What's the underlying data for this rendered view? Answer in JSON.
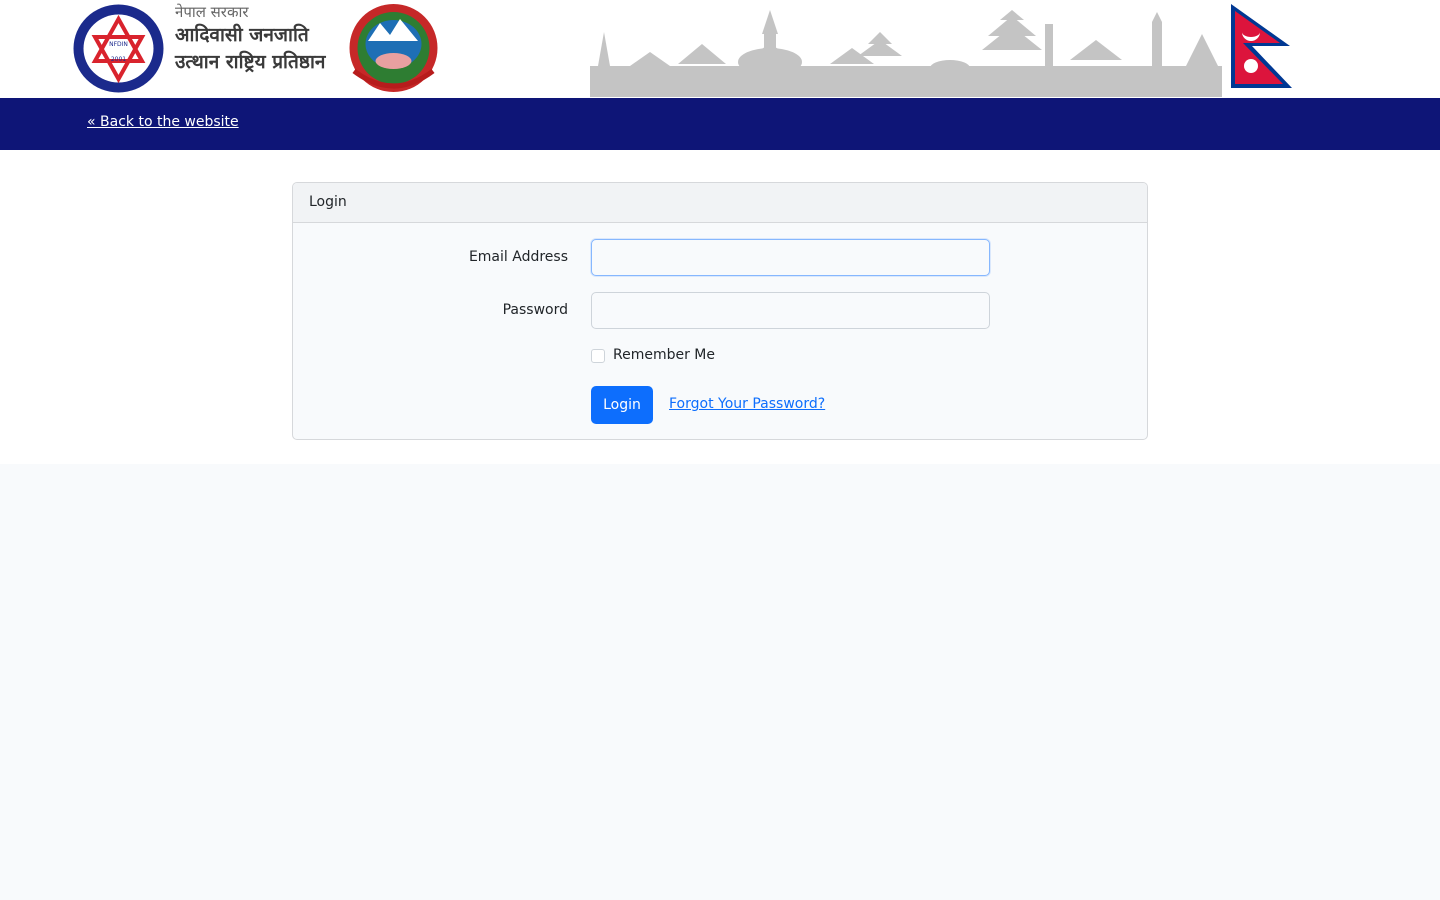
{
  "header": {
    "gov_label": "नेपाल सरकार",
    "org_name_line1": "आदिवासी जनजाति",
    "org_name_line2": "उत्थान राष्ट्रिय प्रतिष्ठान",
    "logo_text": "NFDIN",
    "logo_year": "2001"
  },
  "nav": {
    "back_link": "« Back to the website"
  },
  "login_card": {
    "title": "Login",
    "email_label": "Email Address",
    "email_value": "",
    "password_label": "Password",
    "password_value": "",
    "remember_label": "Remember Me",
    "remember_checked": false,
    "login_button": "Login",
    "forgot_link": "Forgot Your Password?"
  },
  "colors": {
    "navbar": "#0e1577",
    "primary": "#0d6efd",
    "skyline": "#c4c4c4",
    "flag_red": "#dc143c",
    "flag_blue": "#003893"
  }
}
